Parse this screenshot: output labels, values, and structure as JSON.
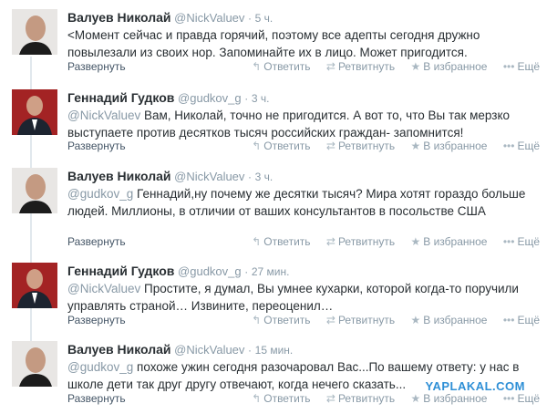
{
  "colors": {
    "name": "#292f33",
    "meta": "#8899a6",
    "expand": "#445566",
    "thread": "#e1e8ed",
    "watermark": "#2e8fd6"
  },
  "actions": {
    "reply": "Ответить",
    "retweet": "Ретвитнуть",
    "favorite": "В избранное",
    "more": "Ещё",
    "expand": "Развернуть"
  },
  "tweets": [
    {
      "name": "Валуев Николай",
      "handle": "@NickValuev",
      "time": "5 ч.",
      "mention": "",
      "text": "<Момент сейчас и правда горячий, поэтому все адепты сегодня дружно повылезали из своих нор. Запоминайте их в лицо. Может пригодится."
    },
    {
      "name": "Геннадий Гудков",
      "handle": "@gudkov_g",
      "time": "3 ч.",
      "mention": "@NickValuev",
      "text": "Вам, Николай, точно не пригодится. А вот то, что Вы так мерзко выступаете против десятков тысяч российских граждан- запомнится!"
    },
    {
      "name": "Валуев Николай",
      "handle": "@NickValuev",
      "time": "3 ч.",
      "mention": "@gudkov_g",
      "text": "Геннадий,ну почему же десятки тысяч? Мира хотят гораздо больше людей. Миллионы, в отличии от ваших консультантов в посольстве США"
    },
    {
      "name": "Геннадий Гудков",
      "handle": "@gudkov_g",
      "time": "27 мин.",
      "mention": "@NickValuev",
      "text": "Простите, я думал, Вы умнее кухарки, которой когда-то поручили управлять страной… Извините, переоценил…"
    },
    {
      "name": "Валуев Николай",
      "handle": "@NickValuev",
      "time": "15 мин.",
      "mention": "@gudkov_g",
      "text": "похоже ужин сегодня разочаровал Вас...По вашему ответу: у нас в школе дети так друг другу отвечают, когда нечего сказать..."
    }
  ],
  "watermark": "YAPLAKAL.COM"
}
